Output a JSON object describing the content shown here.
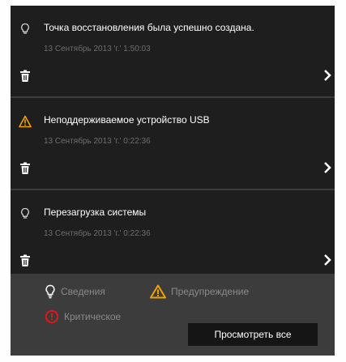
{
  "notifications": [
    {
      "title": "Точка восстановления была успешно создана.",
      "time": "13 Сентябрь 2013 'г.' 1:50:03",
      "icon": "lightbulb-icon"
    },
    {
      "title": "Неподдерживаемое устройство USB",
      "time": "13 Сентябрь 2013 'г.' 0:22:36",
      "icon": "warning-icon"
    },
    {
      "title": "Перезагрузка системы",
      "time": "13 Сентябрь 2013 'г.' 0:22:36",
      "icon": "lightbulb-icon"
    }
  ],
  "legend": {
    "info": "Сведения",
    "warning": "Предупреждение",
    "critical": "Критическое"
  },
  "view_all_label": "Просмотреть все",
  "colors": {
    "panel": "#1e1e1e",
    "footer": "#3c3c3c",
    "warning": "#f0a000",
    "critical": "#e01818",
    "text": "#ffffff",
    "muted": "#6e6e6e"
  }
}
